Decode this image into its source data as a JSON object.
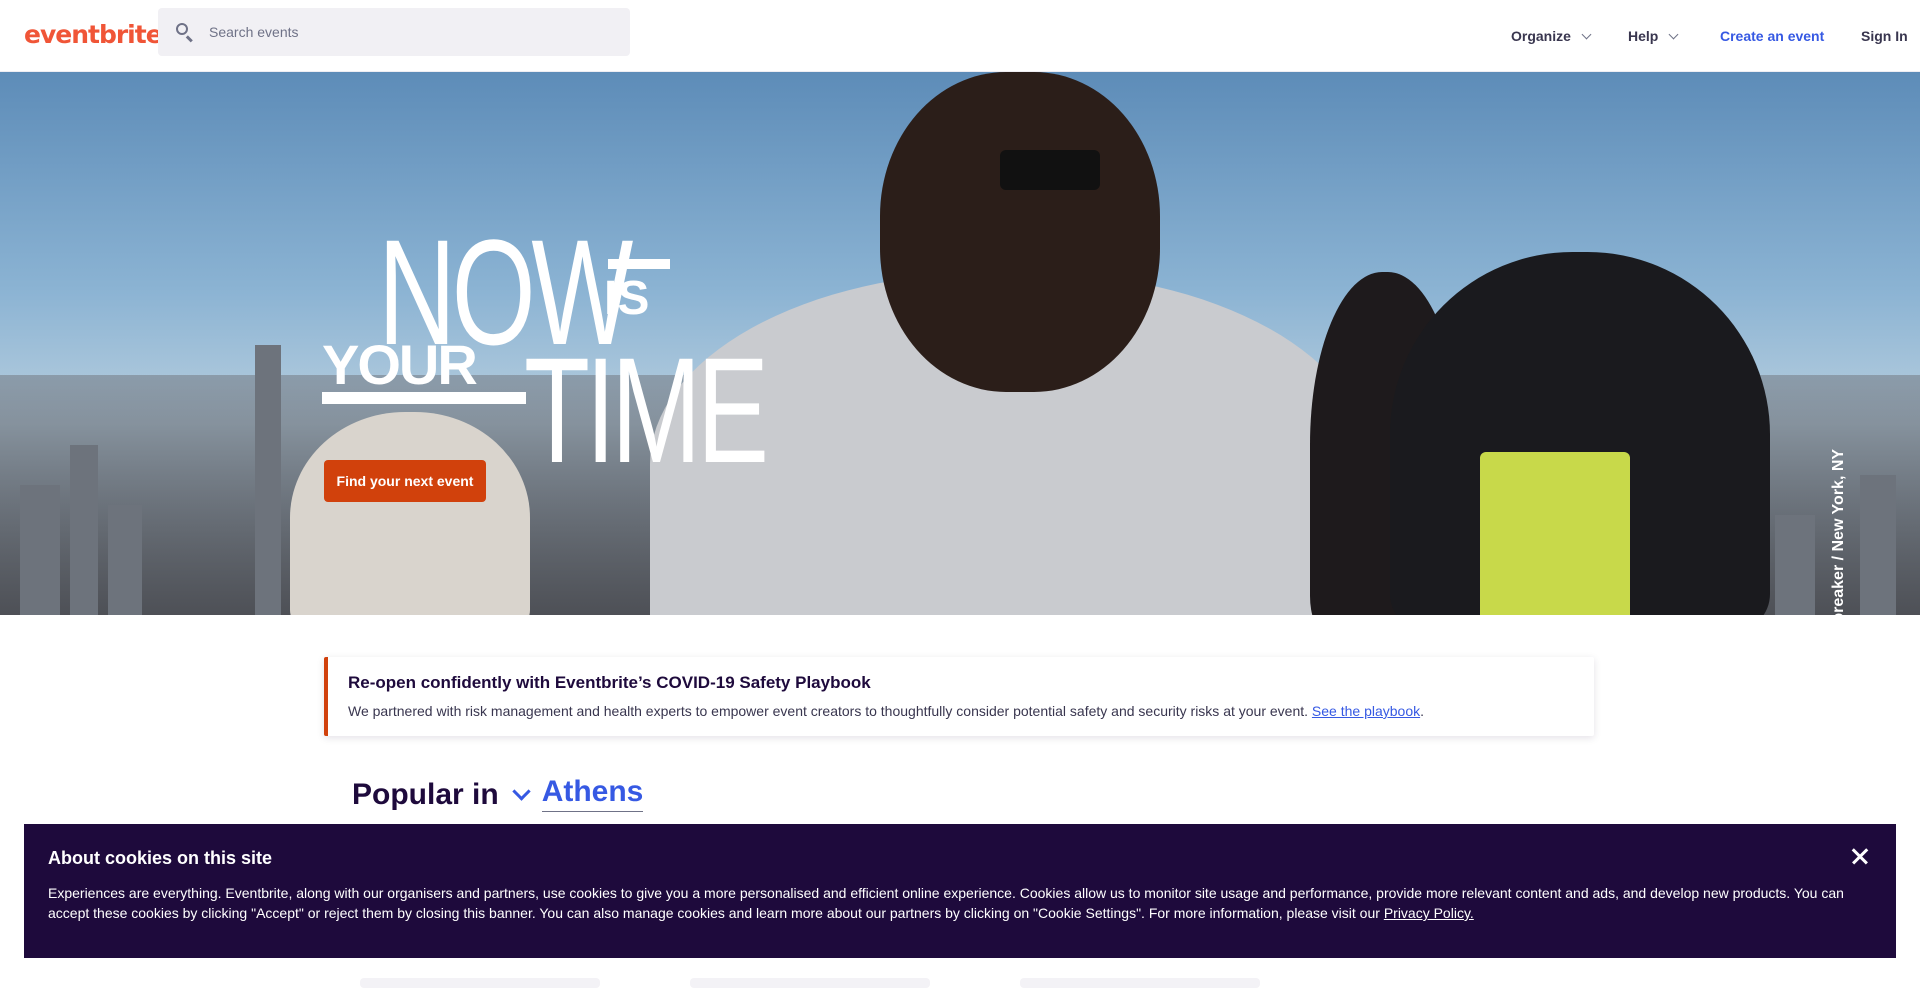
{
  "header": {
    "logo": "eventbrite",
    "search_placeholder": "Search events",
    "nav": {
      "organize": "Organize",
      "help": "Help",
      "create": "Create an event",
      "signin": "Sign In"
    }
  },
  "hero": {
    "tagline": {
      "now": "NOW",
      "is": "IS",
      "your": "YOUR",
      "time": "TIME"
    },
    "cta": "Find your next event",
    "caption": "Daybreaker / New York, NY"
  },
  "notice": {
    "title": "Re-open confidently with Eventbrite’s COVID-19 Safety Playbook",
    "body": "We partnered with risk management and health experts to empower event creators to thoughtfully consider potential safety and security risks at your event.",
    "link": "See the playbook",
    "suffix": "."
  },
  "popular": {
    "label": "Popular in",
    "city": "Athens"
  },
  "cookie": {
    "title": "About cookies on this site",
    "body": "Experiences are everything. Eventbrite, along with our organisers and partners, use cookies to give you a more personalised and efficient online experience. Cookies allow us to monitor site usage and performance, provide more relevant content and ads, and develop new products. You can accept these cookies by clicking \"Accept\" or reject them by closing this banner. You can also manage cookies and learn more about our partners by clicking on \"Cookie Settings\". For more information, please visit our",
    "link": "Privacy Policy."
  },
  "colors": {
    "brand": "#f05537",
    "cta": "#d1410c",
    "link": "#3659e3",
    "banner": "#1e0a3c"
  },
  "icons": {
    "search": "search-icon",
    "close": "close-icon",
    "chevron": "chevron-down-icon"
  }
}
